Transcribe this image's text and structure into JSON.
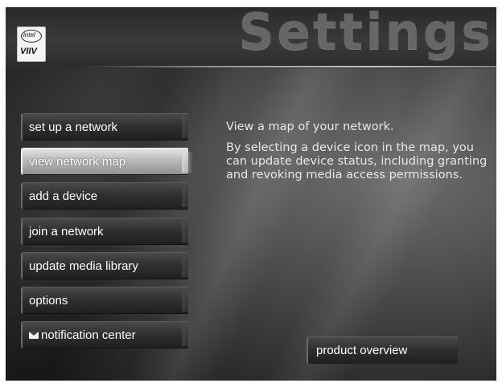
{
  "header": {
    "title": "Settings",
    "logo": {
      "brand": "intel",
      "mark": "VIIV"
    }
  },
  "menu": {
    "items": [
      {
        "label": "set up a network",
        "selected": false
      },
      {
        "label": "view network map",
        "selected": true
      },
      {
        "label": "add a device",
        "selected": false
      },
      {
        "label": "join a network",
        "selected": false
      },
      {
        "label": "update media library",
        "selected": false
      },
      {
        "label": "options",
        "selected": false
      },
      {
        "label": "notification center",
        "selected": false,
        "icon": "envelope-icon"
      }
    ]
  },
  "description": {
    "title": "View a map of your network.",
    "body": "By selecting a device icon in the map, you can update device status, including granting and revoking media access permissions."
  },
  "footer": {
    "product_button": "product overview"
  }
}
